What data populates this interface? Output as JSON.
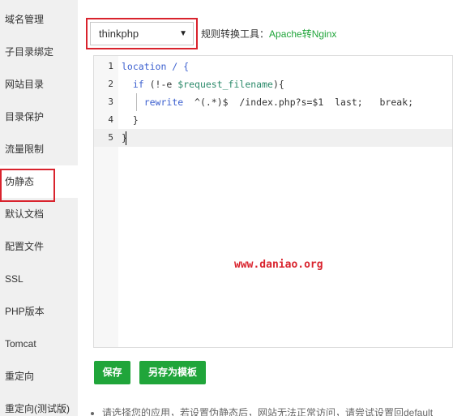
{
  "sidebar": {
    "items": [
      {
        "label": "域名管理"
      },
      {
        "label": "子目录绑定"
      },
      {
        "label": "网站目录"
      },
      {
        "label": "目录保护"
      },
      {
        "label": "流量限制"
      },
      {
        "label": "伪静态"
      },
      {
        "label": "默认文档"
      },
      {
        "label": "配置文件"
      },
      {
        "label": "SSL"
      },
      {
        "label": "PHP版本"
      },
      {
        "label": "Tomcat"
      },
      {
        "label": "重定向"
      },
      {
        "label": "重定向(测试版)"
      }
    ],
    "active_index": 5
  },
  "rewrite": {
    "selected": "thinkphp",
    "tool_label": "规则转换工具：",
    "tool_link": "Apache转Nginx"
  },
  "editor": {
    "lines": [
      {
        "num": "1",
        "code": "location / {"
      },
      {
        "num": "2",
        "code": "  if (!-e $request_filename){"
      },
      {
        "num": "3",
        "code": "    rewrite  ^(.*)$  /index.php?s=$1  last;   break;"
      },
      {
        "num": "4",
        "code": "  }"
      },
      {
        "num": "5",
        "code": "}"
      }
    ],
    "active_line": 5
  },
  "watermark": "www.daniao.org",
  "buttons": {
    "save": "保存",
    "save_as_template": "另存为模板"
  },
  "tip": "请选择您的应用，若设置伪静态后，网站无法正常访问，请尝试设置回default"
}
